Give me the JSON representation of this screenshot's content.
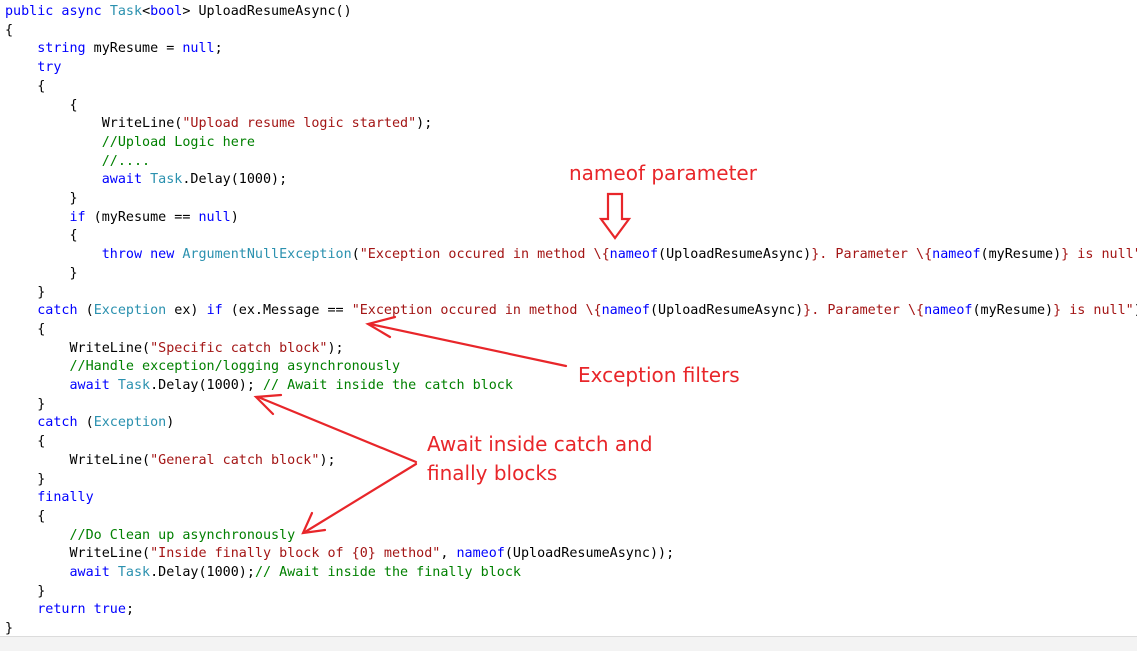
{
  "code_lines": [
    [
      {
        "t": "public async ",
        "c": "kw"
      },
      {
        "t": "Task",
        "c": "ty"
      },
      {
        "t": "<",
        "c": "pl"
      },
      {
        "t": "bool",
        "c": "kw"
      },
      {
        "t": "> UploadResumeAsync()",
        "c": "pl"
      }
    ],
    [
      {
        "t": "{",
        "c": "pl"
      }
    ],
    [
      {
        "t": "    ",
        "c": "pl"
      },
      {
        "t": "string",
        "c": "kw"
      },
      {
        "t": " myResume = ",
        "c": "pl"
      },
      {
        "t": "null",
        "c": "kw"
      },
      {
        "t": ";",
        "c": "pl"
      }
    ],
    [
      {
        "t": "    ",
        "c": "pl"
      },
      {
        "t": "try",
        "c": "kw"
      }
    ],
    [
      {
        "t": "    {",
        "c": "pl"
      }
    ],
    [
      {
        "t": "        {",
        "c": "pl"
      }
    ],
    [
      {
        "t": "            WriteLine(",
        "c": "pl"
      },
      {
        "t": "\"Upload resume logic started\"",
        "c": "st"
      },
      {
        "t": ");",
        "c": "pl"
      }
    ],
    [
      {
        "t": "            ",
        "c": "pl"
      },
      {
        "t": "//Upload Logic here",
        "c": "cm"
      }
    ],
    [
      {
        "t": "            ",
        "c": "pl"
      },
      {
        "t": "//....",
        "c": "cm"
      }
    ],
    [
      {
        "t": "            ",
        "c": "pl"
      },
      {
        "t": "await ",
        "c": "kw"
      },
      {
        "t": "Task",
        "c": "ty"
      },
      {
        "t": ".Delay(1000);",
        "c": "pl"
      }
    ],
    [
      {
        "t": "        }",
        "c": "pl"
      }
    ],
    [
      {
        "t": "        ",
        "c": "pl"
      },
      {
        "t": "if",
        "c": "kw"
      },
      {
        "t": " (myResume == ",
        "c": "pl"
      },
      {
        "t": "null",
        "c": "kw"
      },
      {
        "t": ")",
        "c": "pl"
      }
    ],
    [
      {
        "t": "        {",
        "c": "pl"
      }
    ],
    [
      {
        "t": "            ",
        "c": "pl"
      },
      {
        "t": "throw new ",
        "c": "kw"
      },
      {
        "t": "ArgumentNullException",
        "c": "ty"
      },
      {
        "t": "(",
        "c": "pl"
      },
      {
        "t": "\"Exception occured in method \\{",
        "c": "st"
      },
      {
        "t": "nameof",
        "c": "kw"
      },
      {
        "t": "(UploadResumeAsync)",
        "c": "pl"
      },
      {
        "t": "}. Parameter \\{",
        "c": "st"
      },
      {
        "t": "nameof",
        "c": "kw"
      },
      {
        "t": "(myResume)",
        "c": "pl"
      },
      {
        "t": "} is null\"",
        "c": "st"
      },
      {
        "t": ");",
        "c": "pl"
      }
    ],
    [
      {
        "t": "        }",
        "c": "pl"
      }
    ],
    [
      {
        "t": "    }",
        "c": "pl"
      }
    ],
    [
      {
        "t": "    ",
        "c": "pl"
      },
      {
        "t": "catch",
        "c": "kw"
      },
      {
        "t": " (",
        "c": "pl"
      },
      {
        "t": "Exception",
        "c": "ty"
      },
      {
        "t": " ex) ",
        "c": "pl"
      },
      {
        "t": "if",
        "c": "kw"
      },
      {
        "t": " (ex.Message == ",
        "c": "pl"
      },
      {
        "t": "\"Exception occured in method \\{",
        "c": "st"
      },
      {
        "t": "nameof",
        "c": "kw"
      },
      {
        "t": "(UploadResumeAsync)",
        "c": "pl"
      },
      {
        "t": "}. Parameter \\{",
        "c": "st"
      },
      {
        "t": "nameof",
        "c": "kw"
      },
      {
        "t": "(myResume)",
        "c": "pl"
      },
      {
        "t": "} is null\"",
        "c": "st"
      },
      {
        "t": ")",
        "c": "pl"
      }
    ],
    [
      {
        "t": "    {",
        "c": "pl"
      }
    ],
    [
      {
        "t": "        WriteLine(",
        "c": "pl"
      },
      {
        "t": "\"Specific catch block\"",
        "c": "st"
      },
      {
        "t": ");",
        "c": "pl"
      }
    ],
    [
      {
        "t": "        ",
        "c": "pl"
      },
      {
        "t": "//Handle exception/logging asynchronously",
        "c": "cm"
      }
    ],
    [
      {
        "t": "        ",
        "c": "pl"
      },
      {
        "t": "await ",
        "c": "kw"
      },
      {
        "t": "Task",
        "c": "ty"
      },
      {
        "t": ".Delay(1000); ",
        "c": "pl"
      },
      {
        "t": "// Await inside the catch block",
        "c": "cm"
      }
    ],
    [
      {
        "t": "    }",
        "c": "pl"
      }
    ],
    [
      {
        "t": "    ",
        "c": "pl"
      },
      {
        "t": "catch",
        "c": "kw"
      },
      {
        "t": " (",
        "c": "pl"
      },
      {
        "t": "Exception",
        "c": "ty"
      },
      {
        "t": ")",
        "c": "pl"
      }
    ],
    [
      {
        "t": "    {",
        "c": "pl"
      }
    ],
    [
      {
        "t": "        WriteLine(",
        "c": "pl"
      },
      {
        "t": "\"General catch block\"",
        "c": "st"
      },
      {
        "t": ");",
        "c": "pl"
      }
    ],
    [
      {
        "t": "    }",
        "c": "pl"
      }
    ],
    [
      {
        "t": "    ",
        "c": "pl"
      },
      {
        "t": "finally",
        "c": "kw"
      }
    ],
    [
      {
        "t": "    {",
        "c": "pl"
      }
    ],
    [
      {
        "t": "        ",
        "c": "pl"
      },
      {
        "t": "//Do Clean up asynchronously",
        "c": "cm"
      }
    ],
    [
      {
        "t": "        WriteLine(",
        "c": "pl"
      },
      {
        "t": "\"Inside finally block of {0} method\"",
        "c": "st"
      },
      {
        "t": ", ",
        "c": "pl"
      },
      {
        "t": "nameof",
        "c": "kw"
      },
      {
        "t": "(UploadResumeAsync));",
        "c": "pl"
      }
    ],
    [
      {
        "t": "        ",
        "c": "pl"
      },
      {
        "t": "await ",
        "c": "kw"
      },
      {
        "t": "Task",
        "c": "ty"
      },
      {
        "t": ".Delay(1000);",
        "c": "pl"
      },
      {
        "t": "// Await inside the finally block",
        "c": "cm"
      }
    ],
    [
      {
        "t": "    }",
        "c": "pl"
      }
    ],
    [
      {
        "t": "    ",
        "c": "pl"
      },
      {
        "t": "return true",
        "c": "kw"
      },
      {
        "t": ";",
        "c": "pl"
      }
    ],
    [
      {
        "t": "}",
        "c": "pl"
      }
    ]
  ],
  "annotations": {
    "nameof_label": "nameof parameter",
    "filters_label": "Exception filters",
    "await_label_line1": "Await inside catch and",
    "await_label_line2": "finally blocks"
  },
  "colors": {
    "keyword": "#0000ff",
    "type": "#2b91af",
    "string": "#a31515",
    "comment": "#008000",
    "annotation": "#e8262a"
  }
}
